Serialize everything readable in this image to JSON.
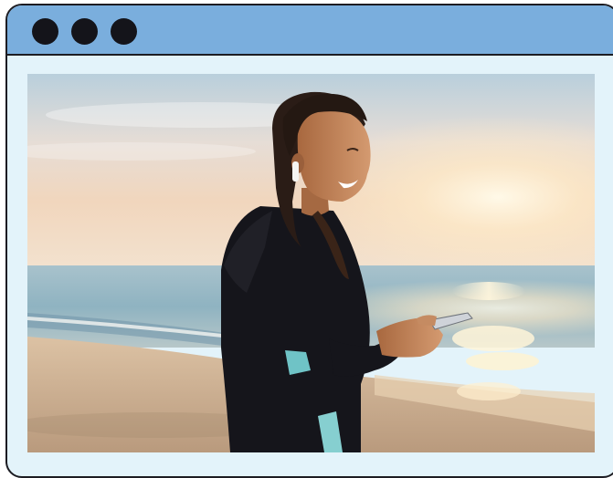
{
  "window": {
    "accent_color": "#7aaedd",
    "frame_color": "#e3f3fa",
    "border_color": "#1c1c22",
    "controls": [
      {
        "icon": "window-dot-icon"
      },
      {
        "icon": "window-dot-icon"
      },
      {
        "icon": "window-dot-icon"
      }
    ]
  },
  "photo": {
    "subject": "woman-on-beach-with-phone"
  }
}
